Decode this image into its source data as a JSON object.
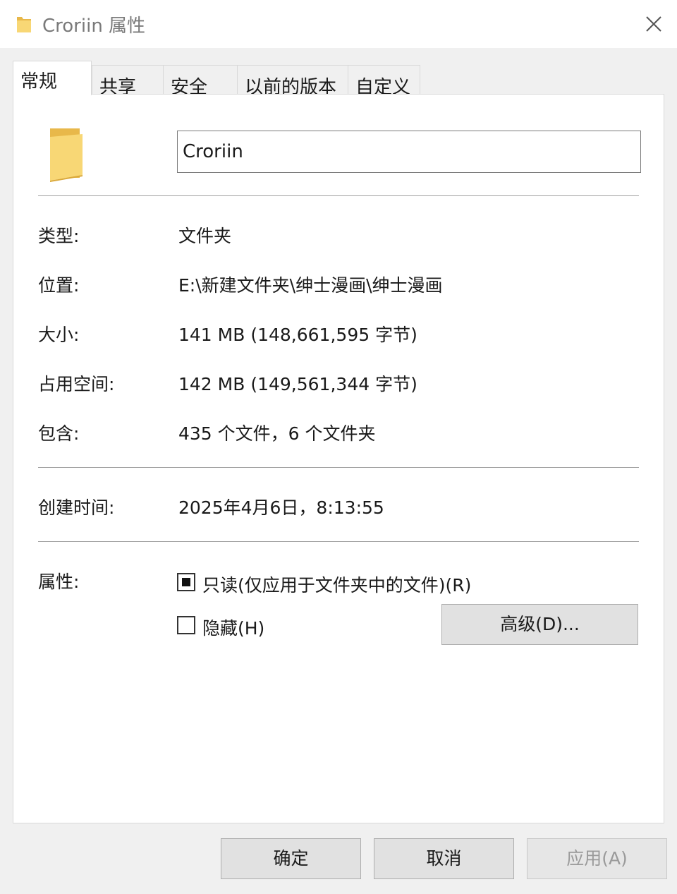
{
  "window": {
    "title": "Croriin 属性"
  },
  "tabs": [
    {
      "label": "常规"
    },
    {
      "label": "共享"
    },
    {
      "label": "安全"
    },
    {
      "label": "以前的版本"
    },
    {
      "label": "自定义"
    }
  ],
  "general": {
    "name_value": "Croriin",
    "type": {
      "label": "类型:",
      "value": "文件夹"
    },
    "location": {
      "label": "位置:",
      "value": "E:\\新建文件夹\\绅士漫画\\绅士漫画"
    },
    "size": {
      "label": "大小:",
      "value": "141 MB (148,661,595 字节)"
    },
    "size_on_disk": {
      "label": "占用空间:",
      "value": "142 MB (149,561,344 字节)"
    },
    "contains": {
      "label": "包含:",
      "value": "435 个文件，6 个文件夹"
    },
    "created": {
      "label": "创建时间:",
      "value": "2025年4月6日，8:13:55"
    },
    "attributes": {
      "label": "属性:",
      "readonly_label": "只读(仅应用于文件夹中的文件)(R)",
      "readonly_state": "indeterminate",
      "hidden_label": "隐藏(H)",
      "hidden_state": "unchecked",
      "advanced_button": "高级(D)..."
    }
  },
  "footer": {
    "ok": "确定",
    "cancel": "取消",
    "apply": "应用(A)"
  },
  "colors": {
    "folder_yellow": "#f8d775",
    "folder_dark": "#e8b84a"
  },
  "icons": [
    "folder-icon",
    "close-icon",
    "folder-large-icon"
  ]
}
